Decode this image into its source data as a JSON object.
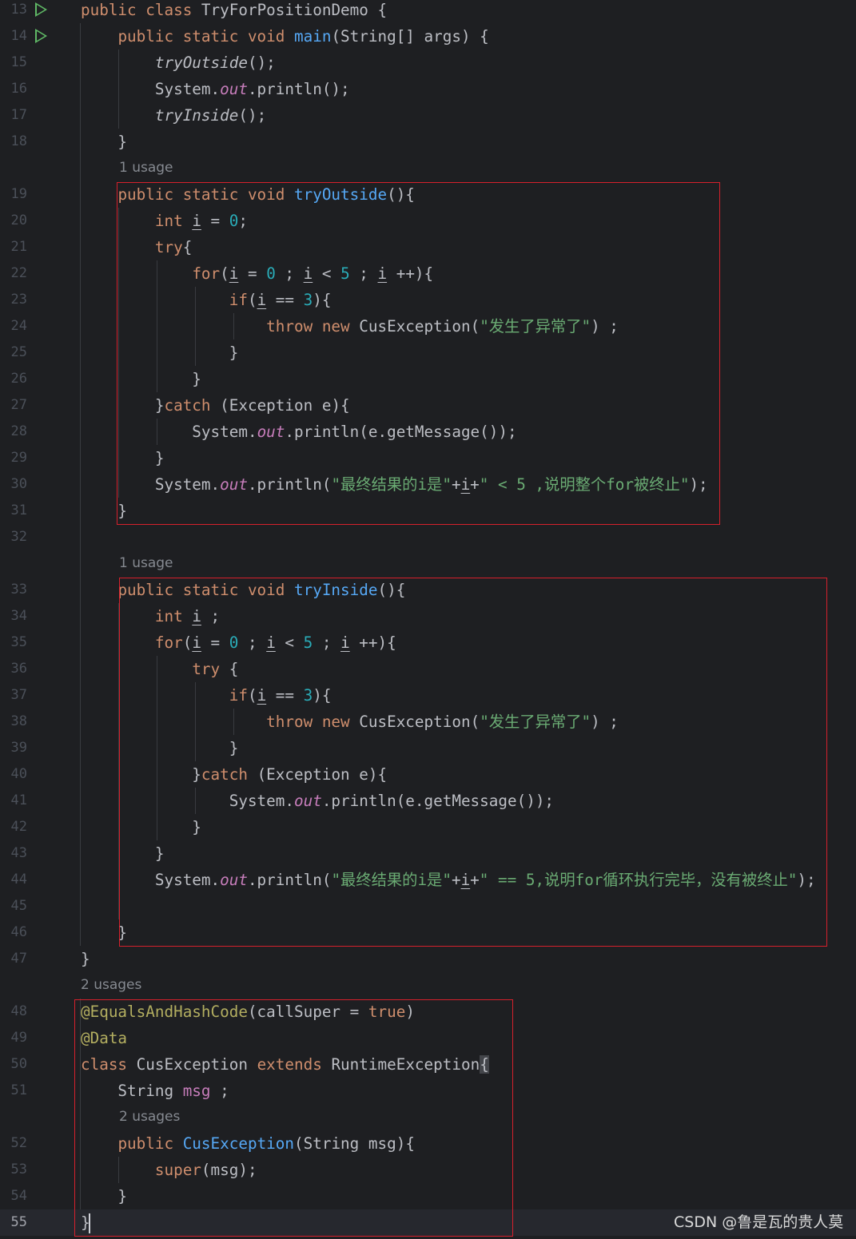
{
  "editor": {
    "language": "java",
    "current_line": "55",
    "lines": [
      {
        "n": "13",
        "tokens": [
          [
            "kw",
            "public class "
          ],
          [
            "",
            "TryForPositionDemo {"
          ]
        ]
      },
      {
        "n": "14",
        "tokens": [
          [
            "",
            "    "
          ],
          [
            "kw",
            "public static void "
          ],
          [
            "fn",
            "main"
          ],
          [
            "",
            "(String[] args) {"
          ]
        ]
      },
      {
        "n": "15",
        "tokens": [
          [
            "",
            "        "
          ],
          [
            "it",
            "tryOutside"
          ],
          [
            "",
            "();"
          ]
        ]
      },
      {
        "n": "16",
        "tokens": [
          [
            "",
            "        System."
          ],
          [
            "st",
            "out"
          ],
          [
            "",
            ".println();"
          ]
        ]
      },
      {
        "n": "17",
        "tokens": [
          [
            "",
            "        "
          ],
          [
            "it",
            "tryInside"
          ],
          [
            "",
            "();"
          ]
        ]
      },
      {
        "n": "18",
        "tokens": [
          [
            "",
            "    }"
          ]
        ]
      },
      {
        "n": "19",
        "hint": "1 usage",
        "tokens": [
          [
            "",
            "    "
          ],
          [
            "kw",
            "public static void "
          ],
          [
            "fn",
            "tryOutside"
          ],
          [
            "",
            "(){"
          ]
        ]
      },
      {
        "n": "20",
        "tokens": [
          [
            "",
            "        "
          ],
          [
            "kw",
            "int "
          ],
          [
            "ul",
            "i"
          ],
          [
            "",
            " = "
          ],
          [
            "num",
            "0"
          ],
          [
            "",
            ";"
          ]
        ]
      },
      {
        "n": "21",
        "tokens": [
          [
            "",
            "        "
          ],
          [
            "kw",
            "try"
          ],
          [
            "",
            "{"
          ]
        ]
      },
      {
        "n": "22",
        "tokens": [
          [
            "",
            "            "
          ],
          [
            "kw",
            "for"
          ],
          [
            "",
            "("
          ],
          [
            "ul",
            "i"
          ],
          [
            "",
            " = "
          ],
          [
            "num",
            "0"
          ],
          [
            "",
            " ; "
          ],
          [
            "ul",
            "i"
          ],
          [
            "",
            " < "
          ],
          [
            "num",
            "5"
          ],
          [
            "",
            " ; "
          ],
          [
            "ul",
            "i"
          ],
          [
            "",
            " ++){"
          ]
        ]
      },
      {
        "n": "23",
        "tokens": [
          [
            "",
            "                "
          ],
          [
            "kw",
            "if"
          ],
          [
            "",
            "("
          ],
          [
            "ul",
            "i"
          ],
          [
            "",
            " == "
          ],
          [
            "num",
            "3"
          ],
          [
            "",
            "){"
          ]
        ]
      },
      {
        "n": "24",
        "tokens": [
          [
            "",
            "                    "
          ],
          [
            "kw",
            "throw new "
          ],
          [
            "",
            "CusException("
          ],
          [
            "str",
            "\"发生了异常了\""
          ],
          [
            "",
            ") ;"
          ]
        ]
      },
      {
        "n": "25",
        "tokens": [
          [
            "",
            "                }"
          ]
        ]
      },
      {
        "n": "26",
        "tokens": [
          [
            "",
            "            }"
          ]
        ]
      },
      {
        "n": "27",
        "tokens": [
          [
            "",
            "        }"
          ],
          [
            "kw",
            "catch "
          ],
          [
            "",
            "(Exception e){"
          ]
        ]
      },
      {
        "n": "28",
        "tokens": [
          [
            "",
            "            System."
          ],
          [
            "st",
            "out"
          ],
          [
            "",
            ".println(e.getMessage());"
          ]
        ]
      },
      {
        "n": "29",
        "tokens": [
          [
            "",
            "        }"
          ]
        ]
      },
      {
        "n": "30",
        "tokens": [
          [
            "",
            "        System."
          ],
          [
            "st",
            "out"
          ],
          [
            "",
            ".println("
          ],
          [
            "str",
            "\"最终结果的i是\""
          ],
          [
            "",
            "+"
          ],
          [
            "ul",
            "i"
          ],
          [
            "",
            "+"
          ],
          [
            "str",
            "\" < 5 ,说明整个for被终止\""
          ],
          [
            "",
            ");"
          ]
        ]
      },
      {
        "n": "31",
        "tokens": [
          [
            "",
            "    }"
          ]
        ]
      },
      {
        "n": "32",
        "tokens": []
      },
      {
        "n": "33",
        "hint": "1 usage",
        "tokens": [
          [
            "",
            "    "
          ],
          [
            "kw",
            "public static void "
          ],
          [
            "fn",
            "tryInside"
          ],
          [
            "",
            "(){"
          ]
        ]
      },
      {
        "n": "34",
        "tokens": [
          [
            "",
            "        "
          ],
          [
            "kw",
            "int "
          ],
          [
            "ul",
            "i"
          ],
          [
            "",
            " ;"
          ]
        ]
      },
      {
        "n": "35",
        "tokens": [
          [
            "",
            "        "
          ],
          [
            "kw",
            "for"
          ],
          [
            "",
            "("
          ],
          [
            "ul",
            "i"
          ],
          [
            "",
            " = "
          ],
          [
            "num",
            "0"
          ],
          [
            "",
            " ; "
          ],
          [
            "ul",
            "i"
          ],
          [
            "",
            " < "
          ],
          [
            "num",
            "5"
          ],
          [
            "",
            " ; "
          ],
          [
            "ul",
            "i"
          ],
          [
            "",
            " ++){"
          ]
        ]
      },
      {
        "n": "36",
        "tokens": [
          [
            "",
            "            "
          ],
          [
            "kw",
            "try "
          ],
          [
            "",
            "{"
          ]
        ]
      },
      {
        "n": "37",
        "tokens": [
          [
            "",
            "                "
          ],
          [
            "kw",
            "if"
          ],
          [
            "",
            "("
          ],
          [
            "ul",
            "i"
          ],
          [
            "",
            " == "
          ],
          [
            "num",
            "3"
          ],
          [
            "",
            "){"
          ]
        ]
      },
      {
        "n": "38",
        "tokens": [
          [
            "",
            "                    "
          ],
          [
            "kw",
            "throw new "
          ],
          [
            "",
            "CusException("
          ],
          [
            "str",
            "\"发生了异常了\""
          ],
          [
            "",
            ") ;"
          ]
        ]
      },
      {
        "n": "39",
        "tokens": [
          [
            "",
            "                }"
          ]
        ]
      },
      {
        "n": "40",
        "tokens": [
          [
            "",
            "            }"
          ],
          [
            "kw",
            "catch "
          ],
          [
            "",
            "(Exception e){"
          ]
        ]
      },
      {
        "n": "41",
        "tokens": [
          [
            "",
            "                System."
          ],
          [
            "st",
            "out"
          ],
          [
            "",
            ".println(e.getMessage());"
          ]
        ]
      },
      {
        "n": "42",
        "tokens": [
          [
            "",
            "            }"
          ]
        ]
      },
      {
        "n": "43",
        "tokens": [
          [
            "",
            "        }"
          ]
        ]
      },
      {
        "n": "44",
        "tokens": [
          [
            "",
            "        System."
          ],
          [
            "st",
            "out"
          ],
          [
            "",
            ".println("
          ],
          [
            "str",
            "\"最终结果的i是\""
          ],
          [
            "",
            "+"
          ],
          [
            "ul",
            "i"
          ],
          [
            "",
            "+"
          ],
          [
            "str",
            "\" == 5,说明for循环执行完毕，没有被终止\""
          ],
          [
            "",
            ");"
          ]
        ]
      },
      {
        "n": "45",
        "tokens": []
      },
      {
        "n": "46",
        "tokens": [
          [
            "",
            "    }"
          ]
        ]
      },
      {
        "n": "47",
        "tokens": [
          [
            "",
            "}"
          ]
        ]
      },
      {
        "n": "48",
        "hint": "2 usages",
        "tokens": [
          [
            "ann",
            "@EqualsAndHashCode"
          ],
          [
            "",
            "(callSuper = "
          ],
          [
            "kw",
            "true"
          ],
          [
            "",
            ")"
          ]
        ]
      },
      {
        "n": "49",
        "tokens": [
          [
            "ann",
            "@Data"
          ]
        ]
      },
      {
        "n": "50",
        "tokens": [
          [
            "kw",
            "class "
          ],
          [
            "",
            "CusException "
          ],
          [
            "kw",
            "extends "
          ],
          [
            "",
            "RuntimeException"
          ],
          [
            "hl",
            "{"
          ]
        ]
      },
      {
        "n": "51",
        "tokens": [
          [
            "",
            "    String "
          ],
          [
            "fld",
            "msg"
          ],
          [
            "",
            " ;"
          ]
        ]
      },
      {
        "n": "52",
        "hint": "2 usages",
        "tokens": [
          [
            "",
            "    "
          ],
          [
            "kw",
            "public "
          ],
          [
            "fn",
            "CusException"
          ],
          [
            "",
            "(String msg){"
          ]
        ]
      },
      {
        "n": "53",
        "tokens": [
          [
            "",
            "        "
          ],
          [
            "kw",
            "super"
          ],
          [
            "",
            "(msg);"
          ]
        ]
      },
      {
        "n": "54",
        "tokens": [
          [
            "",
            "    }"
          ]
        ]
      },
      {
        "n": "55",
        "tokens": [
          [
            "",
            "}"
          ],
          [
            "caret",
            ""
          ]
        ]
      }
    ]
  },
  "run_gutter_lines": [
    "13",
    "14"
  ],
  "watermark": "CSDN @鲁是瓦的贵人莫",
  "colors": {
    "background": "#1e1f22",
    "keyword": "#cf8e6d",
    "function": "#56a8f5",
    "number": "#2aacb8",
    "string": "#6aab73",
    "static_field": "#c77dbb",
    "annotation": "#b3ae60",
    "run_icon": "#5fb865",
    "highlight_box": "#d6202c"
  }
}
